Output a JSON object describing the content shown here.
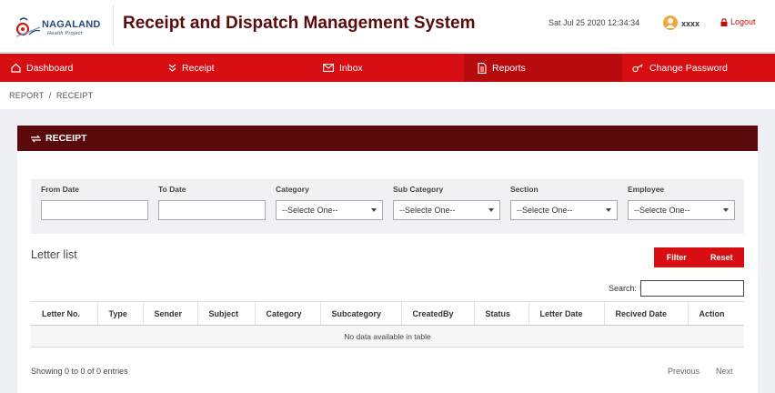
{
  "header": {
    "logo_title": "NAGALAND",
    "logo_subtitle": "Health Project",
    "app_title": "Receipt and Dispatch Management System",
    "datetime": "Sat Jul 25 2020 12:34:34",
    "username": "xxxx",
    "logout_label": "Logout"
  },
  "nav": {
    "items": [
      {
        "label": "Dashboard",
        "icon": "home-icon"
      },
      {
        "label": "Receipt",
        "icon": "chevrons-down-icon"
      },
      {
        "label": "Inbox",
        "icon": "mail-icon"
      },
      {
        "label": "Reports",
        "icon": "file-text-icon",
        "active": true
      },
      {
        "label": "Change Password",
        "icon": "key-icon"
      }
    ]
  },
  "breadcrumb": {
    "text": "REPORT  /  RECEIPT"
  },
  "card": {
    "title": "RECEIPT",
    "filters": {
      "from_date": {
        "label": "From Date",
        "value": ""
      },
      "to_date": {
        "label": "To Date",
        "value": ""
      },
      "category": {
        "label": "Category",
        "selected": "--Selecte One--"
      },
      "sub_category": {
        "label": "Sub Category",
        "selected": "--Selecte One--"
      },
      "section": {
        "label": "Section",
        "selected": "--Selecte One--"
      },
      "employee": {
        "label": "Employee",
        "selected": "--Selecte One--"
      }
    },
    "list_title": "Letter list",
    "filter_button": "Filter",
    "reset_button": "Reset",
    "search_label": "Search:",
    "table": {
      "columns": [
        "Letter No.",
        "Type",
        "Sender",
        "Subject",
        "Category",
        "Subcategory",
        "CreatedBy",
        "Status",
        "Letter Date",
        "Recived Date",
        "Action"
      ],
      "empty_message": "No data available in table"
    },
    "showing_text": "Showing 0 to 0 of 0 entries",
    "pager": {
      "previous": "Previous",
      "next": "Next"
    }
  },
  "colors": {
    "nav_red": "#d70f12",
    "nav_active": "#b80b0e",
    "card_header": "#5a0a0a",
    "title_maroon": "#5a0c0c",
    "logout_red": "#c40a0a",
    "user_badge": "#f2a63c"
  }
}
